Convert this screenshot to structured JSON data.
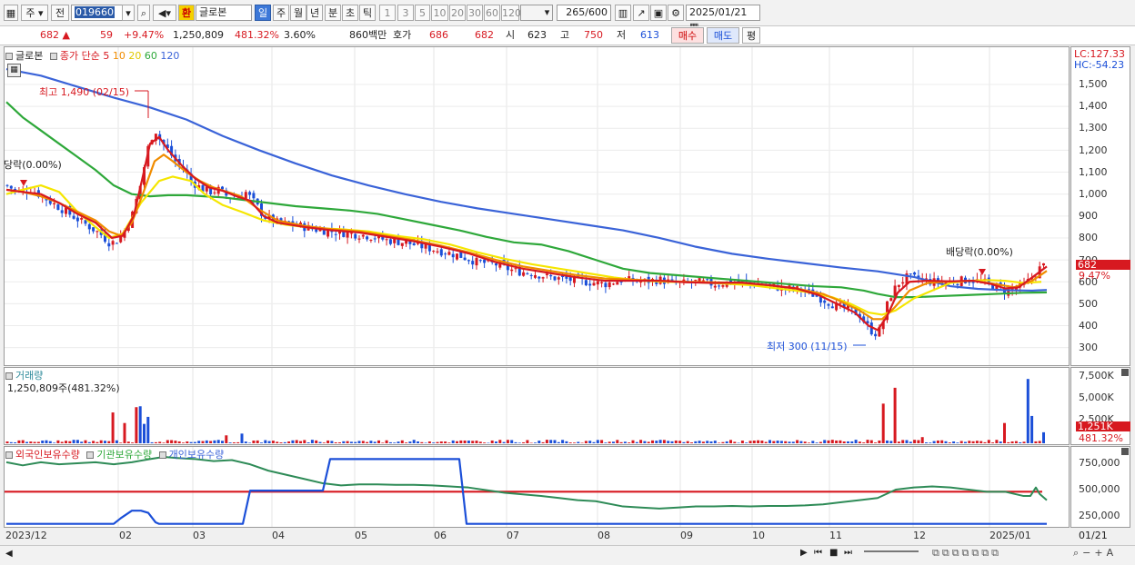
{
  "toolbar": {
    "period_week": "주",
    "prev_label": "전",
    "stock_code": "019660",
    "exchange_badge": "환",
    "stock_name": "글로본",
    "periods": [
      "일",
      "주",
      "월",
      "년",
      "분",
      "초",
      "틱"
    ],
    "selected_period": "일",
    "intervals": [
      "1",
      "3",
      "5",
      "10",
      "20",
      "30",
      "60",
      "120"
    ],
    "count": "265",
    "count_max": "/600",
    "date": "2025/01/21"
  },
  "quote": {
    "price": "682 ▲",
    "change": "59",
    "change_pct": "+9.47%",
    "volume": "1,250,809",
    "volume_ratio": "481.32%",
    "turnover": "3.60%",
    "amount": "860백만",
    "ask_label": "호가",
    "ask": "686",
    "bid": "682",
    "open_label": "시",
    "open": "623",
    "high_label": "고",
    "high": "750",
    "low_label": "저",
    "low": "613",
    "buy_label": "매수",
    "sell_label": "매도",
    "eval_label": "평"
  },
  "price_panel": {
    "name": "글로본",
    "ma_title": "종가 단순",
    "ma_periods": [
      "5",
      "10",
      "20",
      "60",
      "120"
    ],
    "lc": "LC:127.33",
    "hc": "HC:-54.23",
    "high_note": "최고 1,490 (02/15)",
    "low_note": "최저 300 (11/15)",
    "div_note_left": "당락(0.00%)",
    "div_note_right": "배당락(0.00%)",
    "price_tag": "682",
    "pct_tag": "9.47%"
  },
  "volume_panel": {
    "title": "거래량",
    "value": "1,250,809주(481.32%)",
    "tag": "1,251K",
    "pct_tag": "481.32%"
  },
  "holding_panel": {
    "legend": [
      "외국인보유수량",
      "기관보유수량",
      "개인보유수량"
    ]
  },
  "bottom_axis": {
    "right_label": "01/21"
  },
  "chart_data": {
    "type": "line",
    "price_axis_ticks": [
      "1,500",
      "1,400",
      "1,300",
      "1,200",
      "1,100",
      "1,000",
      "900",
      "800",
      "700",
      "600",
      "500",
      "400",
      "300"
    ],
    "volume_axis_ticks": [
      "7,500K",
      "5,000K",
      "2,500K"
    ],
    "holding_axis_ticks": [
      "750,000",
      "500,000",
      "250,000"
    ],
    "x_tick_labels": [
      "2023/12",
      "02",
      "03",
      "04",
      "05",
      "06",
      "07",
      "08",
      "09",
      "10",
      "11",
      "12",
      "2025/01"
    ],
    "series": [
      {
        "name": "5",
        "color": "#d71920"
      },
      {
        "name": "10",
        "color": "#f08c00"
      },
      {
        "name": "20",
        "color": "#f5e600"
      },
      {
        "name": "60",
        "color": "#2ea83a"
      },
      {
        "name": "120",
        "color": "#3a63d8"
      }
    ],
    "ma20_path": [
      [
        2,
        1000
      ],
      [
        20,
        1020
      ],
      [
        40,
        1040
      ],
      [
        60,
        1010
      ],
      [
        80,
        920
      ],
      [
        100,
        850
      ],
      [
        115,
        800
      ],
      [
        130,
        820
      ],
      [
        150,
        960
      ],
      [
        170,
        1060
      ],
      [
        185,
        1080
      ],
      [
        205,
        1060
      ],
      [
        220,
        1000
      ],
      [
        240,
        950
      ],
      [
        260,
        920
      ],
      [
        285,
        880
      ],
      [
        310,
        860
      ],
      [
        340,
        845
      ],
      [
        370,
        840
      ],
      [
        400,
        830
      ],
      [
        430,
        810
      ],
      [
        460,
        795
      ],
      [
        490,
        770
      ],
      [
        520,
        735
      ],
      [
        550,
        705
      ],
      [
        580,
        680
      ],
      [
        610,
        660
      ],
      [
        640,
        640
      ],
      [
        670,
        620
      ],
      [
        700,
        605
      ],
      [
        730,
        600
      ],
      [
        760,
        598
      ],
      [
        790,
        592
      ],
      [
        820,
        585
      ],
      [
        850,
        570
      ],
      [
        880,
        555
      ],
      [
        910,
        530
      ],
      [
        930,
        500
      ],
      [
        950,
        460
      ],
      [
        965,
        450
      ],
      [
        980,
        470
      ],
      [
        1000,
        525
      ],
      [
        1020,
        560
      ],
      [
        1040,
        595
      ],
      [
        1060,
        605
      ],
      [
        1080,
        608
      ],
      [
        1100,
        605
      ],
      [
        1120,
        595
      ],
      [
        1140,
        600
      ]
    ],
    "ma60_path": [
      [
        2,
        1420
      ],
      [
        20,
        1350
      ],
      [
        40,
        1290
      ],
      [
        60,
        1230
      ],
      [
        80,
        1170
      ],
      [
        100,
        1110
      ],
      [
        120,
        1040
      ],
      [
        140,
        1000
      ],
      [
        160,
        990
      ],
      [
        180,
        995
      ],
      [
        200,
        995
      ],
      [
        220,
        990
      ],
      [
        240,
        985
      ],
      [
        260,
        975
      ],
      [
        290,
        960
      ],
      [
        320,
        945
      ],
      [
        350,
        935
      ],
      [
        380,
        925
      ],
      [
        410,
        910
      ],
      [
        440,
        885
      ],
      [
        470,
        860
      ],
      [
        500,
        835
      ],
      [
        530,
        805
      ],
      [
        560,
        780
      ],
      [
        590,
        770
      ],
      [
        620,
        740
      ],
      [
        650,
        700
      ],
      [
        680,
        660
      ],
      [
        710,
        640
      ],
      [
        740,
        630
      ],
      [
        770,
        620
      ],
      [
        800,
        610
      ],
      [
        830,
        600
      ],
      [
        860,
        590
      ],
      [
        890,
        580
      ],
      [
        920,
        575
      ],
      [
        945,
        560
      ],
      [
        960,
        545
      ],
      [
        980,
        530
      ],
      [
        1000,
        530
      ],
      [
        1030,
        535
      ],
      [
        1060,
        540
      ],
      [
        1090,
        545
      ],
      [
        1120,
        550
      ],
      [
        1146,
        552
      ]
    ],
    "ma120_path": [
      [
        2,
        1570
      ],
      [
        40,
        1540
      ],
      [
        80,
        1490
      ],
      [
        120,
        1440
      ],
      [
        160,
        1395
      ],
      [
        200,
        1340
      ],
      [
        240,
        1265
      ],
      [
        280,
        1200
      ],
      [
        320,
        1140
      ],
      [
        360,
        1085
      ],
      [
        400,
        1040
      ],
      [
        440,
        1000
      ],
      [
        480,
        965
      ],
      [
        520,
        935
      ],
      [
        560,
        910
      ],
      [
        600,
        885
      ],
      [
        640,
        860
      ],
      [
        680,
        835
      ],
      [
        720,
        800
      ],
      [
        760,
        760
      ],
      [
        800,
        728
      ],
      [
        840,
        705
      ],
      [
        880,
        685
      ],
      [
        920,
        665
      ],
      [
        960,
        648
      ],
      [
        1000,
        622
      ],
      [
        1040,
        580
      ],
      [
        1070,
        568
      ],
      [
        1100,
        562
      ],
      [
        1130,
        560
      ],
      [
        1146,
        563
      ]
    ],
    "close_path": [
      [
        2,
        1040
      ],
      [
        15,
        1010
      ],
      [
        30,
        1020
      ],
      [
        45,
        980
      ],
      [
        60,
        940
      ],
      [
        75,
        900
      ],
      [
        90,
        860
      ],
      [
        105,
        820
      ],
      [
        115,
        780
      ],
      [
        122,
        780
      ],
      [
        130,
        820
      ],
      [
        140,
        900
      ],
      [
        150,
        1050
      ],
      [
        157,
        1200
      ],
      [
        165,
        1300
      ],
      [
        172,
        1240
      ],
      [
        180,
        1200
      ],
      [
        188,
        1150
      ],
      [
        196,
        1120
      ],
      [
        205,
        1060
      ],
      [
        215,
        1030
      ],
      [
        225,
        1010
      ],
      [
        235,
        1020
      ],
      [
        245,
        990
      ],
      [
        255,
        980
      ],
      [
        265,
        1010
      ],
      [
        275,
        960
      ],
      [
        285,
        900
      ],
      [
        300,
        870
      ],
      [
        320,
        860
      ],
      [
        340,
        840
      ],
      [
        360,
        830
      ],
      [
        380,
        820
      ],
      [
        400,
        810
      ],
      [
        420,
        790
      ],
      [
        440,
        780
      ],
      [
        460,
        760
      ],
      [
        480,
        740
      ],
      [
        500,
        720
      ],
      [
        520,
        690
      ],
      [
        540,
        680
      ],
      [
        560,
        650
      ],
      [
        580,
        640
      ],
      [
        600,
        620
      ],
      [
        620,
        610
      ],
      [
        640,
        600
      ],
      [
        660,
        590
      ],
      [
        680,
        610
      ],
      [
        700,
        600
      ],
      [
        720,
        610
      ],
      [
        740,
        590
      ],
      [
        760,
        600
      ],
      [
        780,
        590
      ],
      [
        800,
        600
      ],
      [
        820,
        595
      ],
      [
        840,
        580
      ],
      [
        860,
        570
      ],
      [
        880,
        560
      ],
      [
        900,
        520
      ],
      [
        915,
        490
      ],
      [
        930,
        470
      ],
      [
        940,
        450
      ],
      [
        952,
        380
      ],
      [
        960,
        360
      ],
      [
        966,
        420
      ],
      [
        972,
        520
      ],
      [
        982,
        590
      ],
      [
        992,
        620
      ],
      [
        1005,
        615
      ],
      [
        1020,
        600
      ],
      [
        1040,
        600
      ],
      [
        1060,
        610
      ],
      [
        1075,
        600
      ],
      [
        1090,
        580
      ],
      [
        1100,
        560
      ],
      [
        1110,
        570
      ],
      [
        1120,
        580
      ],
      [
        1130,
        620
      ],
      [
        1138,
        660
      ],
      [
        1146,
        682
      ]
    ],
    "ma10_path": [
      [
        2,
        1020
      ],
      [
        20,
        1010
      ],
      [
        40,
        990
      ],
      [
        60,
        960
      ],
      [
        80,
        920
      ],
      [
        100,
        880
      ],
      [
        115,
        830
      ],
      [
        128,
        810
      ],
      [
        140,
        870
      ],
      [
        152,
        1000
      ],
      [
        165,
        1150
      ],
      [
        175,
        1180
      ],
      [
        185,
        1150
      ],
      [
        200,
        1100
      ],
      [
        215,
        1060
      ],
      [
        230,
        1030
      ],
      [
        245,
        1010
      ],
      [
        260,
        990
      ],
      [
        280,
        930
      ],
      [
        300,
        880
      ],
      [
        330,
        855
      ],
      [
        360,
        840
      ],
      [
        390,
        830
      ],
      [
        420,
        810
      ],
      [
        450,
        790
      ],
      [
        480,
        765
      ],
      [
        510,
        735
      ],
      [
        540,
        700
      ],
      [
        570,
        670
      ],
      [
        600,
        650
      ],
      [
        630,
        630
      ],
      [
        660,
        615
      ],
      [
        690,
        610
      ],
      [
        720,
        605
      ],
      [
        750,
        600
      ],
      [
        780,
        598
      ],
      [
        810,
        595
      ],
      [
        840,
        585
      ],
      [
        870,
        570
      ],
      [
        900,
        545
      ],
      [
        920,
        510
      ],
      [
        940,
        470
      ],
      [
        955,
        430
      ],
      [
        965,
        430
      ],
      [
        978,
        480
      ],
      [
        995,
        560
      ],
      [
        1015,
        595
      ],
      [
        1040,
        602
      ],
      [
        1065,
        605
      ],
      [
        1090,
        590
      ],
      [
        1110,
        575
      ],
      [
        1130,
        605
      ],
      [
        1146,
        650
      ]
    ],
    "ma5_path": [
      [
        2,
        1020
      ],
      [
        20,
        1010
      ],
      [
        40,
        1000
      ],
      [
        60,
        960
      ],
      [
        80,
        910
      ],
      [
        100,
        870
      ],
      [
        118,
        800
      ],
      [
        130,
        810
      ],
      [
        142,
        900
      ],
      [
        152,
        1080
      ],
      [
        160,
        1230
      ],
      [
        170,
        1260
      ],
      [
        180,
        1200
      ],
      [
        195,
        1130
      ],
      [
        210,
        1070
      ],
      [
        225,
        1030
      ],
      [
        240,
        1015
      ],
      [
        255,
        990
      ],
      [
        270,
        970
      ],
      [
        285,
        900
      ],
      [
        300,
        870
      ],
      [
        330,
        850
      ],
      [
        360,
        835
      ],
      [
        390,
        825
      ],
      [
        420,
        805
      ],
      [
        450,
        785
      ],
      [
        480,
        760
      ],
      [
        510,
        730
      ],
      [
        540,
        690
      ],
      [
        570,
        660
      ],
      [
        600,
        640
      ],
      [
        630,
        620
      ],
      [
        660,
        605
      ],
      [
        690,
        605
      ],
      [
        720,
        605
      ],
      [
        750,
        598
      ],
      [
        780,
        595
      ],
      [
        810,
        597
      ],
      [
        840,
        585
      ],
      [
        870,
        570
      ],
      [
        895,
        540
      ],
      [
        915,
        500
      ],
      [
        935,
        460
      ],
      [
        950,
        400
      ],
      [
        960,
        380
      ],
      [
        970,
        440
      ],
      [
        982,
        550
      ],
      [
        995,
        600
      ],
      [
        1015,
        605
      ],
      [
        1040,
        602
      ],
      [
        1065,
        605
      ],
      [
        1085,
        590
      ],
      [
        1100,
        570
      ],
      [
        1115,
        575
      ],
      [
        1130,
        620
      ],
      [
        1146,
        670
      ]
    ],
    "foreign_holding_path": [
      [
        2,
        175
      ],
      [
        120,
        175
      ],
      [
        128,
        230
      ],
      [
        140,
        300
      ],
      [
        150,
        300
      ],
      [
        158,
        280
      ],
      [
        166,
        190
      ],
      [
        170,
        175
      ],
      [
        262,
        175
      ],
      [
        270,
        490
      ],
      [
        350,
        490
      ],
      [
        358,
        790
      ],
      [
        500,
        790
      ],
      [
        508,
        175
      ],
      [
        1146,
        175
      ]
    ],
    "institution_holding_level": 480000,
    "individual_holding_path": [
      [
        2,
        760
      ],
      [
        20,
        730
      ],
      [
        40,
        760
      ],
      [
        60,
        740
      ],
      [
        80,
        750
      ],
      [
        100,
        760
      ],
      [
        120,
        740
      ],
      [
        140,
        760
      ],
      [
        160,
        790
      ],
      [
        175,
        810
      ],
      [
        190,
        800
      ],
      [
        210,
        790
      ],
      [
        230,
        770
      ],
      [
        250,
        780
      ],
      [
        270,
        740
      ],
      [
        290,
        680
      ],
      [
        310,
        640
      ],
      [
        330,
        600
      ],
      [
        350,
        560
      ],
      [
        370,
        540
      ],
      [
        390,
        550
      ],
      [
        410,
        550
      ],
      [
        430,
        545
      ],
      [
        450,
        545
      ],
      [
        470,
        540
      ],
      [
        490,
        530
      ],
      [
        510,
        520
      ],
      [
        530,
        495
      ],
      [
        550,
        470
      ],
      [
        570,
        455
      ],
      [
        590,
        440
      ],
      [
        610,
        420
      ],
      [
        630,
        400
      ],
      [
        650,
        390
      ],
      [
        680,
        340
      ],
      [
        700,
        330
      ],
      [
        720,
        320
      ],
      [
        740,
        330
      ],
      [
        760,
        340
      ],
      [
        780,
        340
      ],
      [
        800,
        345
      ],
      [
        820,
        340
      ],
      [
        840,
        345
      ],
      [
        860,
        345
      ],
      [
        880,
        350
      ],
      [
        900,
        360
      ],
      [
        920,
        380
      ],
      [
        940,
        400
      ],
      [
        960,
        420
      ],
      [
        980,
        500
      ],
      [
        1000,
        520
      ],
      [
        1020,
        530
      ],
      [
        1040,
        520
      ],
      [
        1060,
        500
      ],
      [
        1080,
        480
      ],
      [
        1100,
        480
      ],
      [
        1120,
        440
      ],
      [
        1128,
        440
      ],
      [
        1134,
        520
      ],
      [
        1138,
        460
      ],
      [
        1146,
        400
      ]
    ]
  }
}
